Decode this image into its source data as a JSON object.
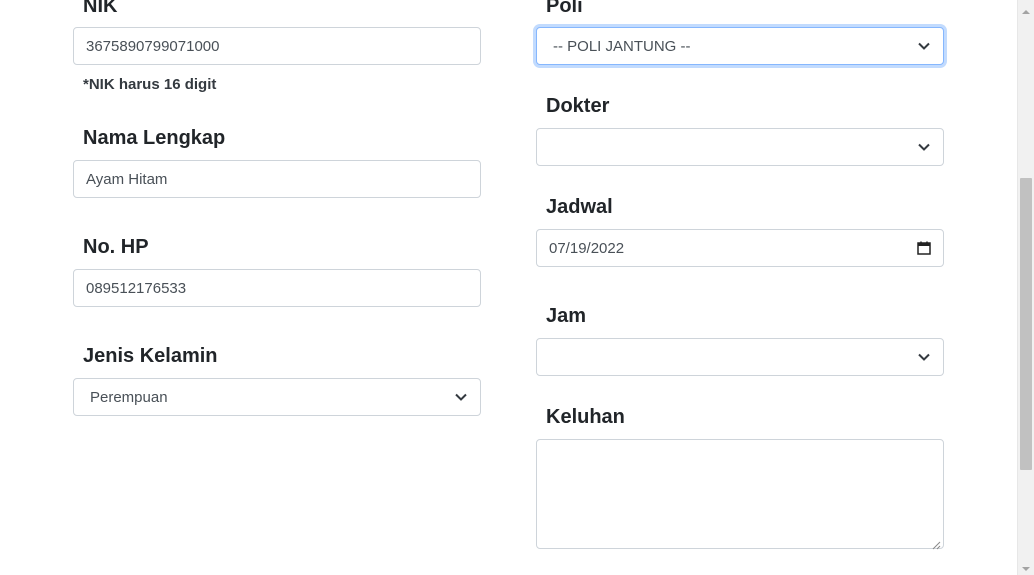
{
  "left": {
    "nik": {
      "label": "NIK",
      "value": "3675890799071000",
      "hint": "*NIK harus 16 digit"
    },
    "nama": {
      "label": "Nama Lengkap",
      "value": "Ayam Hitam"
    },
    "hp": {
      "label": "No. HP",
      "value": "089512176533"
    },
    "jenis_kelamin": {
      "label": "Jenis Kelamin",
      "selected": "Perempuan"
    }
  },
  "right": {
    "poli": {
      "label": "Poli",
      "selected": "-- POLI JANTUNG --"
    },
    "dokter": {
      "label": "Dokter",
      "selected": ""
    },
    "jadwal": {
      "label": "Jadwal",
      "value": "07/19/2022"
    },
    "jam": {
      "label": "Jam",
      "selected": ""
    },
    "keluhan": {
      "label": "Keluhan",
      "value": ""
    }
  },
  "icons": {
    "select_arrow": "chevron-down-icon",
    "date_picker": "calendar-icon",
    "textarea_resize": "resize-grip-icon"
  },
  "colors": {
    "focus_border": "#86b7fe",
    "field_border": "#ced4da",
    "label_text": "#212529"
  }
}
